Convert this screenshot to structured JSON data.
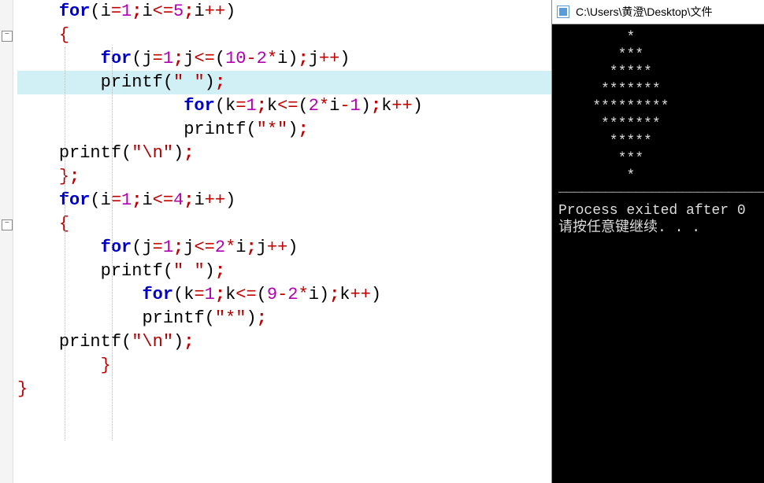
{
  "editor": {
    "lines": [
      {
        "indent": 1,
        "tokens": [
          [
            "kw",
            "for"
          ],
          [
            "paren",
            "("
          ],
          [
            "fn",
            "i"
          ],
          [
            "op",
            "="
          ],
          [
            "num",
            "1"
          ],
          [
            "op b",
            ";"
          ],
          [
            "fn",
            "i"
          ],
          [
            "op",
            "<="
          ],
          [
            "num",
            "5"
          ],
          [
            "op b",
            ";"
          ],
          [
            "fn",
            "i"
          ],
          [
            "op",
            "++"
          ],
          [
            "paren",
            ")"
          ]
        ]
      },
      {
        "indent": 1,
        "tokens": [
          [
            "br",
            "{"
          ]
        ]
      },
      {
        "indent": 2,
        "tokens": [
          [
            "kw",
            "for"
          ],
          [
            "paren",
            "("
          ],
          [
            "fn",
            "j"
          ],
          [
            "op",
            "="
          ],
          [
            "num",
            "1"
          ],
          [
            "op b",
            ";"
          ],
          [
            "fn",
            "j"
          ],
          [
            "op",
            "<="
          ],
          [
            "paren",
            "("
          ],
          [
            "num",
            "10"
          ],
          [
            "op",
            "-"
          ],
          [
            "num",
            "2"
          ],
          [
            "op",
            "*"
          ],
          [
            "fn",
            "i"
          ],
          [
            "paren",
            ")"
          ],
          [
            "op b",
            ";"
          ],
          [
            "fn",
            "j"
          ],
          [
            "op",
            "++"
          ],
          [
            "paren",
            ")"
          ]
        ]
      },
      {
        "indent": 2,
        "hl": true,
        "tokens": [
          [
            "fn",
            "printf"
          ],
          [
            "paren",
            "("
          ],
          [
            "str",
            "\" \""
          ],
          [
            "paren",
            ")"
          ],
          [
            "op b",
            ";"
          ]
        ]
      },
      {
        "indent": 4,
        "tokens": [
          [
            "kw",
            "for"
          ],
          [
            "paren",
            "("
          ],
          [
            "fn",
            "k"
          ],
          [
            "op",
            "="
          ],
          [
            "num",
            "1"
          ],
          [
            "op b",
            ";"
          ],
          [
            "fn",
            "k"
          ],
          [
            "op",
            "<="
          ],
          [
            "paren",
            "("
          ],
          [
            "num",
            "2"
          ],
          [
            "op",
            "*"
          ],
          [
            "fn",
            "i"
          ],
          [
            "op",
            "-"
          ],
          [
            "num",
            "1"
          ],
          [
            "paren",
            ")"
          ],
          [
            "op b",
            ";"
          ],
          [
            "fn",
            "k"
          ],
          [
            "op",
            "++"
          ],
          [
            "paren",
            ")"
          ]
        ]
      },
      {
        "indent": 4,
        "tokens": [
          [
            "fn",
            "printf"
          ],
          [
            "paren",
            "("
          ],
          [
            "str",
            "\"*\""
          ],
          [
            "paren",
            ")"
          ],
          [
            "op b",
            ";"
          ]
        ]
      },
      {
        "indent": 1,
        "tokens": [
          [
            "fn",
            "printf"
          ],
          [
            "paren",
            "("
          ],
          [
            "str",
            "\"\\n\""
          ],
          [
            "paren",
            ")"
          ],
          [
            "op b",
            ";"
          ]
        ]
      },
      {
        "indent": 1,
        "tokens": [
          [
            "br",
            "}"
          ],
          [
            "op b",
            ";"
          ]
        ]
      },
      {
        "indent": 1,
        "tokens": [
          [
            "kw",
            "for"
          ],
          [
            "paren",
            "("
          ],
          [
            "fn",
            "i"
          ],
          [
            "op",
            "="
          ],
          [
            "num",
            "1"
          ],
          [
            "op b",
            ";"
          ],
          [
            "fn",
            "i"
          ],
          [
            "op",
            "<="
          ],
          [
            "num",
            "4"
          ],
          [
            "op b",
            ";"
          ],
          [
            "fn",
            "i"
          ],
          [
            "op",
            "++"
          ],
          [
            "paren",
            ")"
          ]
        ]
      },
      {
        "indent": 1,
        "tokens": [
          [
            "br",
            "{"
          ]
        ]
      },
      {
        "indent": 2,
        "tokens": [
          [
            "kw",
            "for"
          ],
          [
            "paren",
            "("
          ],
          [
            "fn",
            "j"
          ],
          [
            "op",
            "="
          ],
          [
            "num",
            "1"
          ],
          [
            "op b",
            ";"
          ],
          [
            "fn",
            "j"
          ],
          [
            "op",
            "<="
          ],
          [
            "num",
            "2"
          ],
          [
            "op",
            "*"
          ],
          [
            "fn",
            "i"
          ],
          [
            "op b",
            ";"
          ],
          [
            "fn",
            "j"
          ],
          [
            "op",
            "++"
          ],
          [
            "paren",
            ")"
          ]
        ]
      },
      {
        "indent": 2,
        "tokens": [
          [
            "fn",
            "printf"
          ],
          [
            "paren",
            "("
          ],
          [
            "str",
            "\" \""
          ],
          [
            "paren",
            ")"
          ],
          [
            "op b",
            ";"
          ]
        ]
      },
      {
        "indent": 3,
        "tokens": [
          [
            "kw",
            "for"
          ],
          [
            "paren",
            "("
          ],
          [
            "fn",
            "k"
          ],
          [
            "op",
            "="
          ],
          [
            "num",
            "1"
          ],
          [
            "op b",
            ";"
          ],
          [
            "fn",
            "k"
          ],
          [
            "op",
            "<="
          ],
          [
            "paren",
            "("
          ],
          [
            "num",
            "9"
          ],
          [
            "op",
            "-"
          ],
          [
            "num",
            "2"
          ],
          [
            "op",
            "*"
          ],
          [
            "fn",
            "i"
          ],
          [
            "paren",
            ")"
          ],
          [
            "op b",
            ";"
          ],
          [
            "fn",
            "k"
          ],
          [
            "op",
            "++"
          ],
          [
            "paren",
            ")"
          ]
        ]
      },
      {
        "indent": 3,
        "tokens": [
          [
            "fn",
            "printf"
          ],
          [
            "paren",
            "("
          ],
          [
            "str",
            "\"*\""
          ],
          [
            "paren",
            ")"
          ],
          [
            "op b",
            ";"
          ]
        ]
      },
      {
        "indent": 1,
        "tokens": [
          [
            "fn",
            "printf"
          ],
          [
            "paren",
            "("
          ],
          [
            "str",
            "\"\\n\""
          ],
          [
            "paren",
            ")"
          ],
          [
            "op b",
            ";"
          ]
        ]
      },
      {
        "indent": 2,
        "tokens": [
          [
            "br",
            "}"
          ]
        ]
      },
      {
        "indent": 0,
        "tokens": [
          [
            "br",
            "}"
          ]
        ]
      }
    ],
    "fold_marks": [
      1,
      9
    ]
  },
  "console": {
    "title": "C:\\Users\\黄澄\\Desktop\\文件",
    "output": [
      "        *",
      "       ***",
      "      *****",
      "     *******",
      "    *********",
      "     *******",
      "      *****",
      "       ***",
      "        *",
      "",
      "--------------------------------",
      "Process exited after 0",
      "请按任意键继续. . ."
    ]
  }
}
